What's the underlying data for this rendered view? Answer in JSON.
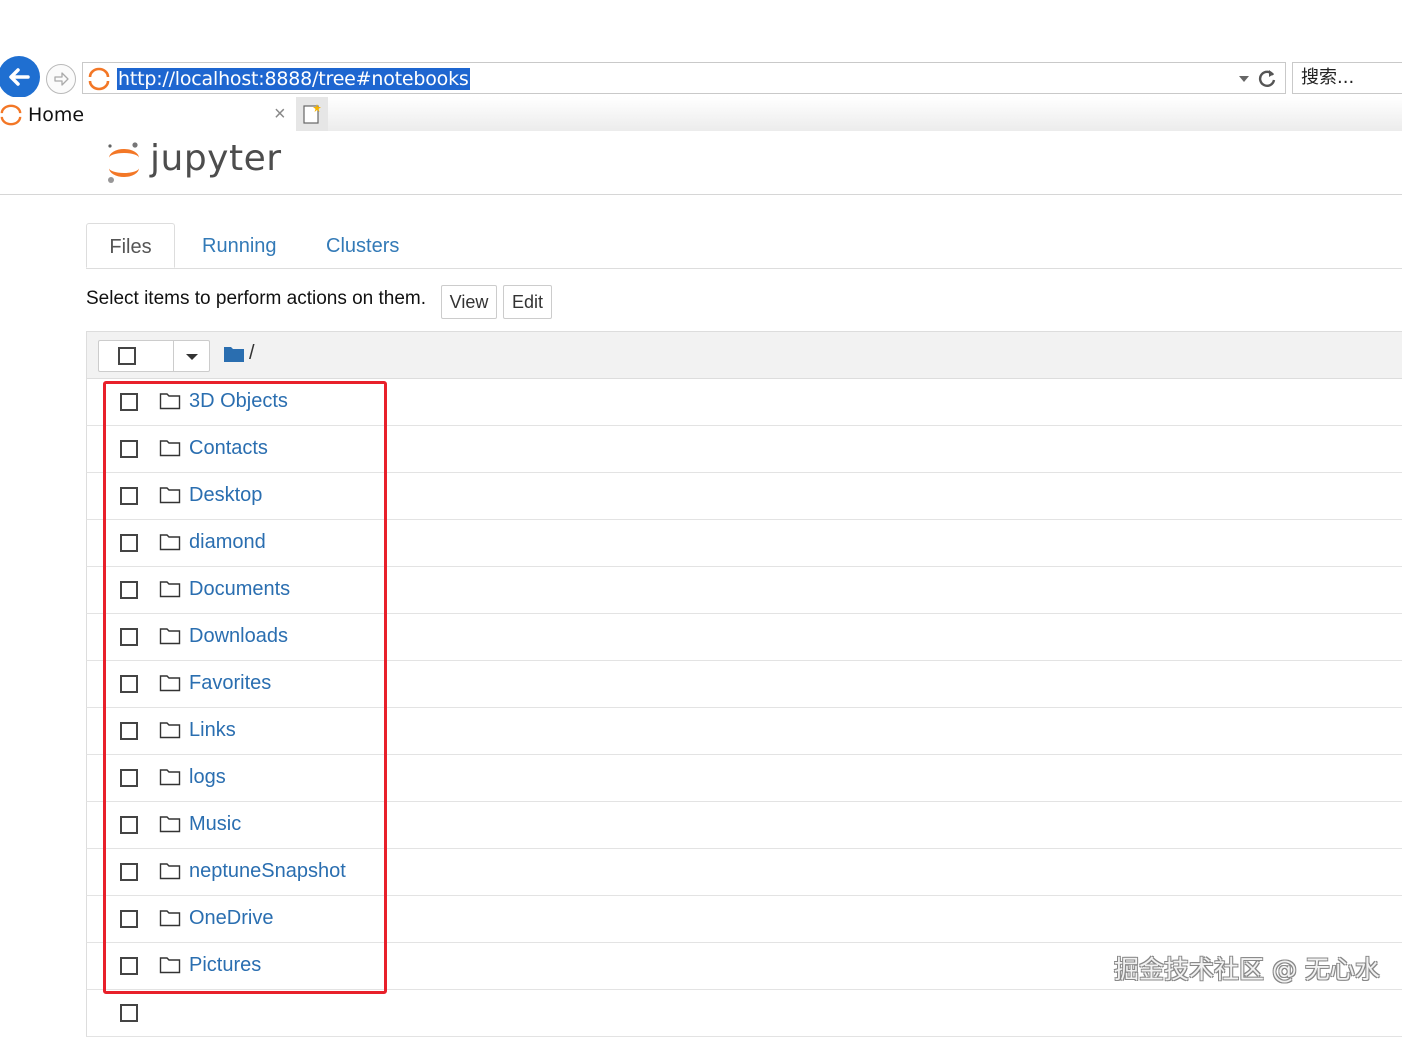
{
  "browser": {
    "url": "http://localhost:8888/tree#notebooks",
    "search_placeholder": "搜索...",
    "tab_title": "Home",
    "tab_close": "×"
  },
  "app": {
    "wordmark": "jupyter",
    "accent_color": "#f37726",
    "link_color": "#2a6eb0"
  },
  "tabs": [
    {
      "label": "Files",
      "active": true
    },
    {
      "label": "Running",
      "active": false
    },
    {
      "label": "Clusters",
      "active": false
    }
  ],
  "toolbar": {
    "hint": "Select items to perform actions on them.",
    "view_label": "View",
    "edit_label": "Edit"
  },
  "breadcrumb": {
    "root": "/"
  },
  "files": [
    "3D Objects",
    "Contacts",
    "Desktop",
    "diamond",
    "Documents",
    "Downloads",
    "Favorites",
    "Links",
    "logs",
    "Music",
    "neptuneSnapshot",
    "OneDrive",
    "Pictures"
  ],
  "highlight_color": "#e8202a",
  "watermark": "掘金技术社区 @ 无心水"
}
